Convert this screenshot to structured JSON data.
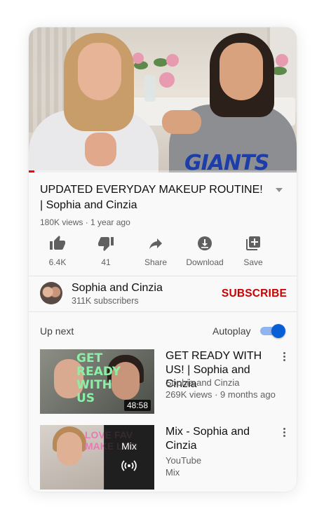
{
  "video": {
    "title": "UPDATED EVERYDAY MAKEUP ROUTINE! | Sophia and Cinzia",
    "meta": "180K views · 1 year ago",
    "progress": 0.02,
    "shirt_text": "GIANTS"
  },
  "actions": [
    {
      "icon": "thumbs-up-icon",
      "label": "6.4K"
    },
    {
      "icon": "thumbs-down-icon",
      "label": "41"
    },
    {
      "icon": "share-icon",
      "label": "Share"
    },
    {
      "icon": "download-icon",
      "label": "Download"
    },
    {
      "icon": "save-playlist-icon",
      "label": "Save"
    }
  ],
  "channel": {
    "name": "Sophia and Cinzia",
    "subscribers": "311K subscribers",
    "subscribe_label": "SUBSCRIBE"
  },
  "upnext": {
    "heading": "Up next",
    "autoplay_label": "Autoplay",
    "autoplay_on": true,
    "items": [
      {
        "title": "GET READY WITH US! | Sophia and Cinzia",
        "channel": "Sophia and Cinzia",
        "stats": "269K views · 9 months ago",
        "duration": "48:58",
        "thumb_text": "GET READY WITH US"
      },
      {
        "title": "Mix - Sophia and Cinzia",
        "channel": "YouTube",
        "stats": "Mix",
        "overlay_label": "Mix",
        "thumb_text": "LOVE FAV MAKE LOO"
      }
    ]
  },
  "colors": {
    "subscribe": "#cc0000",
    "toggle_on": "#065fd4",
    "progress": "#ff0000"
  }
}
